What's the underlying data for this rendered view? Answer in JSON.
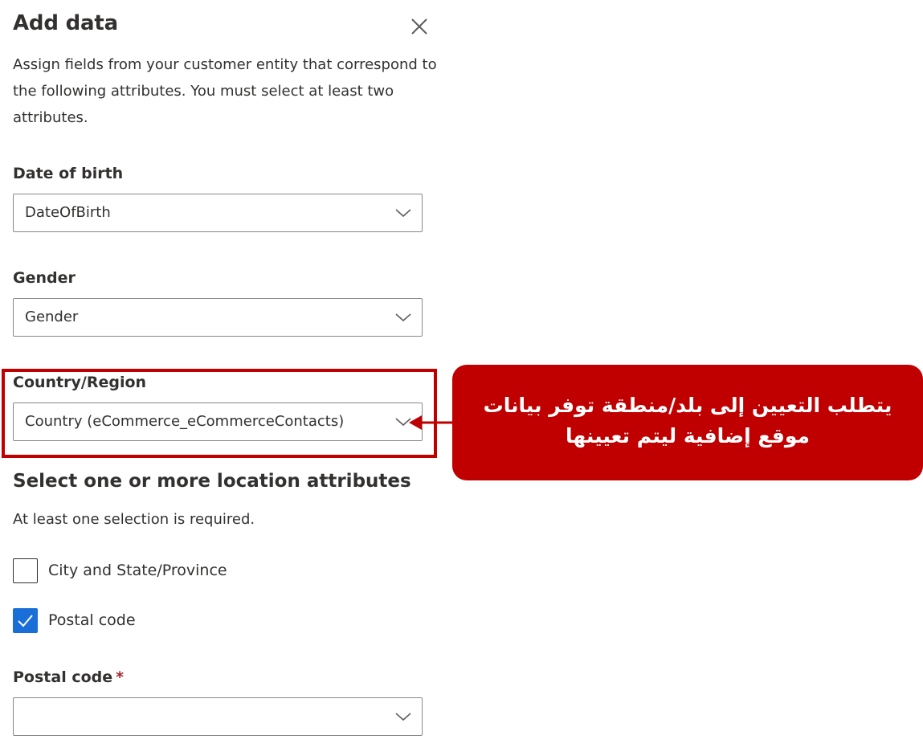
{
  "panel": {
    "title": "Add data",
    "description": "Assign fields from your customer entity that correspond to the following attributes. You must select at least two attributes."
  },
  "fields": {
    "date_of_birth": {
      "label": "Date of birth",
      "value": "DateOfBirth"
    },
    "gender": {
      "label": "Gender",
      "value": "Gender"
    },
    "country_region": {
      "label": "Country/Region",
      "value": "Country (eCommerce_eCommerceContacts)"
    }
  },
  "location": {
    "heading": "Select one or more location attributes",
    "hint": "At least one selection is required.",
    "options": [
      {
        "label": "City and State/Province",
        "checked": false
      },
      {
        "label": "Postal code",
        "checked": true
      }
    ]
  },
  "postal_code": {
    "label": "Postal code",
    "required_marker": "*",
    "value": ""
  },
  "callout": {
    "text": "يتطلب التعيين إلى بلد/منطقة توفر بيانات موقع إضافية ليتم تعيينها"
  },
  "colors": {
    "callout_bg": "#c00000",
    "checkbox_checked": "#1a6ed8",
    "text": "#323130",
    "border": "#8a8886"
  },
  "icons": {
    "close": "close-icon",
    "chevron": "chevron-down-icon",
    "check": "checkmark-icon",
    "arrow": "arrow-left-icon"
  }
}
